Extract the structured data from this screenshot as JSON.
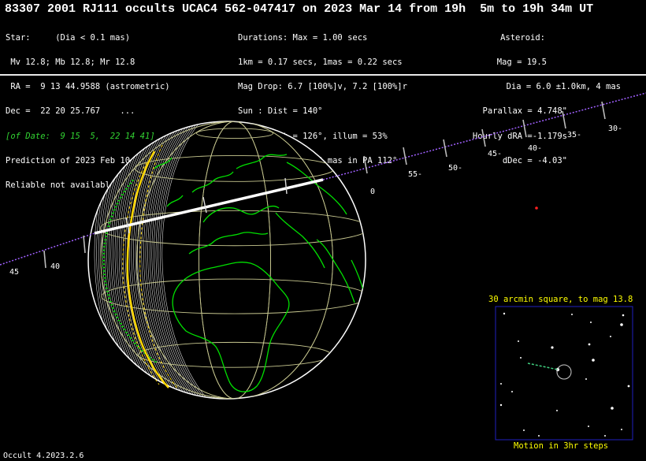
{
  "title": "83307 2001 RJ111 occults UCAC4 562-047417 on 2023 Mar 14 from 19h  5m to 19h 34m UT",
  "star": [
    "Star:     (Dia < 0.1 mas)",
    " Mv 12.8; Mb 12.8; Mr 12.8",
    " RA =  9 13 44.9588 (astrometric)",
    "Dec =  22 20 25.767    ...",
    "[of Date:  9 15  5,  22 14 41]",
    "Prediction of 2023 Feb 10.0",
    "Reliable not available"
  ],
  "event": [
    "Durations: Max = 1.00 secs",
    "1km = 0.17 secs, 1mas = 0.22 secs",
    "Mag Drop: 6.7 [100%]v, 7.2 [100%]r",
    "Sun : Dist = 140°",
    "Moon: Dist = 126°, illum = 53%",
    "Error 36.0 x 20.0 mas in PA 112°"
  ],
  "asteroid": [
    "Asteroid:",
    "Mag = 19.5",
    "Dia = 6.0 ±1.0km, 4 mas",
    "Parallax = 4.748\"",
    "Hourly dRA =-1.179s",
    "dDec = -4.03\""
  ],
  "path_ticks_right": [
    "0",
    "55-",
    "50-",
    "45-",
    "40-",
    "35-",
    "30-"
  ],
  "path_ticks_left": [
    "45",
    "40"
  ],
  "finder": {
    "label_top": "30 arcmin square, to mag 13.8",
    "label_bottom": "Motion in 3hr steps"
  },
  "footer": "Occult 4.2023.2.6",
  "colors": {
    "path": "#a060ff",
    "grid": "#c8c890",
    "coast": "#00e000",
    "limb": "#ffd700",
    "finder_box": "#2020c0",
    "label": "#ffff00"
  }
}
